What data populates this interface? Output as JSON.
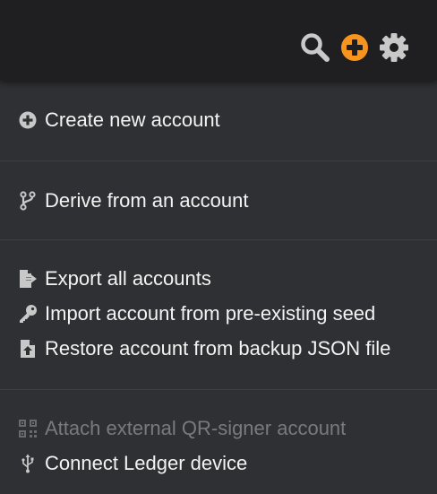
{
  "topbar": {
    "icons": [
      "search-icon",
      "add-circle-icon",
      "gear-icon"
    ],
    "accent_color": "#f7941d"
  },
  "menu": {
    "create_account": "Create new account",
    "derive_account": "Derive from an account",
    "export_all": "Export all accounts",
    "import_seed": "Import account from pre-existing seed",
    "restore_json": "Restore account from backup JSON file",
    "attach_qr": "Attach external QR-signer account",
    "connect_ledger": "Connect Ledger device"
  },
  "colors": {
    "topbar_bg": "#1f1f21",
    "menu_bg": "#2f3033",
    "text": "#f3f3f3",
    "disabled_text": "#7a7a7d",
    "icon_gray": "#c8c8c8"
  }
}
